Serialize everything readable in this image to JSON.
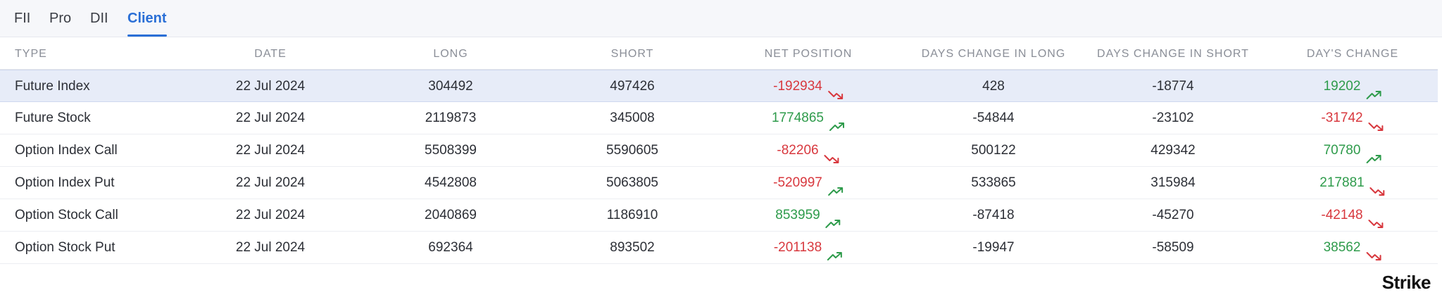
{
  "tabs": [
    {
      "label": "FII",
      "active": false
    },
    {
      "label": "Pro",
      "active": false
    },
    {
      "label": "DII",
      "active": false
    },
    {
      "label": "Client",
      "active": true
    }
  ],
  "table": {
    "headers": [
      "TYPE",
      "DATE",
      "LONG",
      "SHORT",
      "NET POSITION",
      "DAYS CHANGE IN LONG",
      "DAYS CHANGE IN SHORT",
      "DAY'S CHANGE"
    ],
    "rows": [
      {
        "type": "Future Index",
        "date": "22 Jul 2024",
        "long": "304492",
        "short": "497426",
        "net_position": "-192934",
        "net_trend": "down",
        "days_change_long": "428",
        "days_change_short": "-18774",
        "days_change": "19202",
        "day_trend": "up"
      },
      {
        "type": "Future Stock",
        "date": "22 Jul 2024",
        "long": "2119873",
        "short": "345008",
        "net_position": "1774865",
        "net_trend": "up",
        "days_change_long": "-54844",
        "days_change_short": "-23102",
        "days_change": "-31742",
        "day_trend": "down"
      },
      {
        "type": "Option Index Call",
        "date": "22 Jul 2024",
        "long": "5508399",
        "short": "5590605",
        "net_position": "-82206",
        "net_trend": "down",
        "days_change_long": "500122",
        "days_change_short": "429342",
        "days_change": "70780",
        "day_trend": "up"
      },
      {
        "type": "Option Index Put",
        "date": "22 Jul 2024",
        "long": "4542808",
        "short": "5063805",
        "net_position": "-520997",
        "net_trend": "up",
        "days_change_long": "533865",
        "days_change_short": "315984",
        "days_change": "217881",
        "day_trend": "down"
      },
      {
        "type": "Option Stock Call",
        "date": "22 Jul 2024",
        "long": "2040869",
        "short": "1186910",
        "net_position": "853959",
        "net_trend": "up",
        "days_change_long": "-87418",
        "days_change_short": "-45270",
        "days_change": "-42148",
        "day_trend": "down"
      },
      {
        "type": "Option Stock Put",
        "date": "22 Jul 2024",
        "long": "692364",
        "short": "893502",
        "net_position": "-201138",
        "net_trend": "up",
        "days_change_long": "-19947",
        "days_change_short": "-58509",
        "days_change": "38562",
        "day_trend": "down"
      }
    ]
  },
  "colors": {
    "up": "#2e9b4b",
    "down": "#d8383e",
    "accent": "#2a6fd6"
  },
  "logo": {
    "text": "Strike"
  }
}
